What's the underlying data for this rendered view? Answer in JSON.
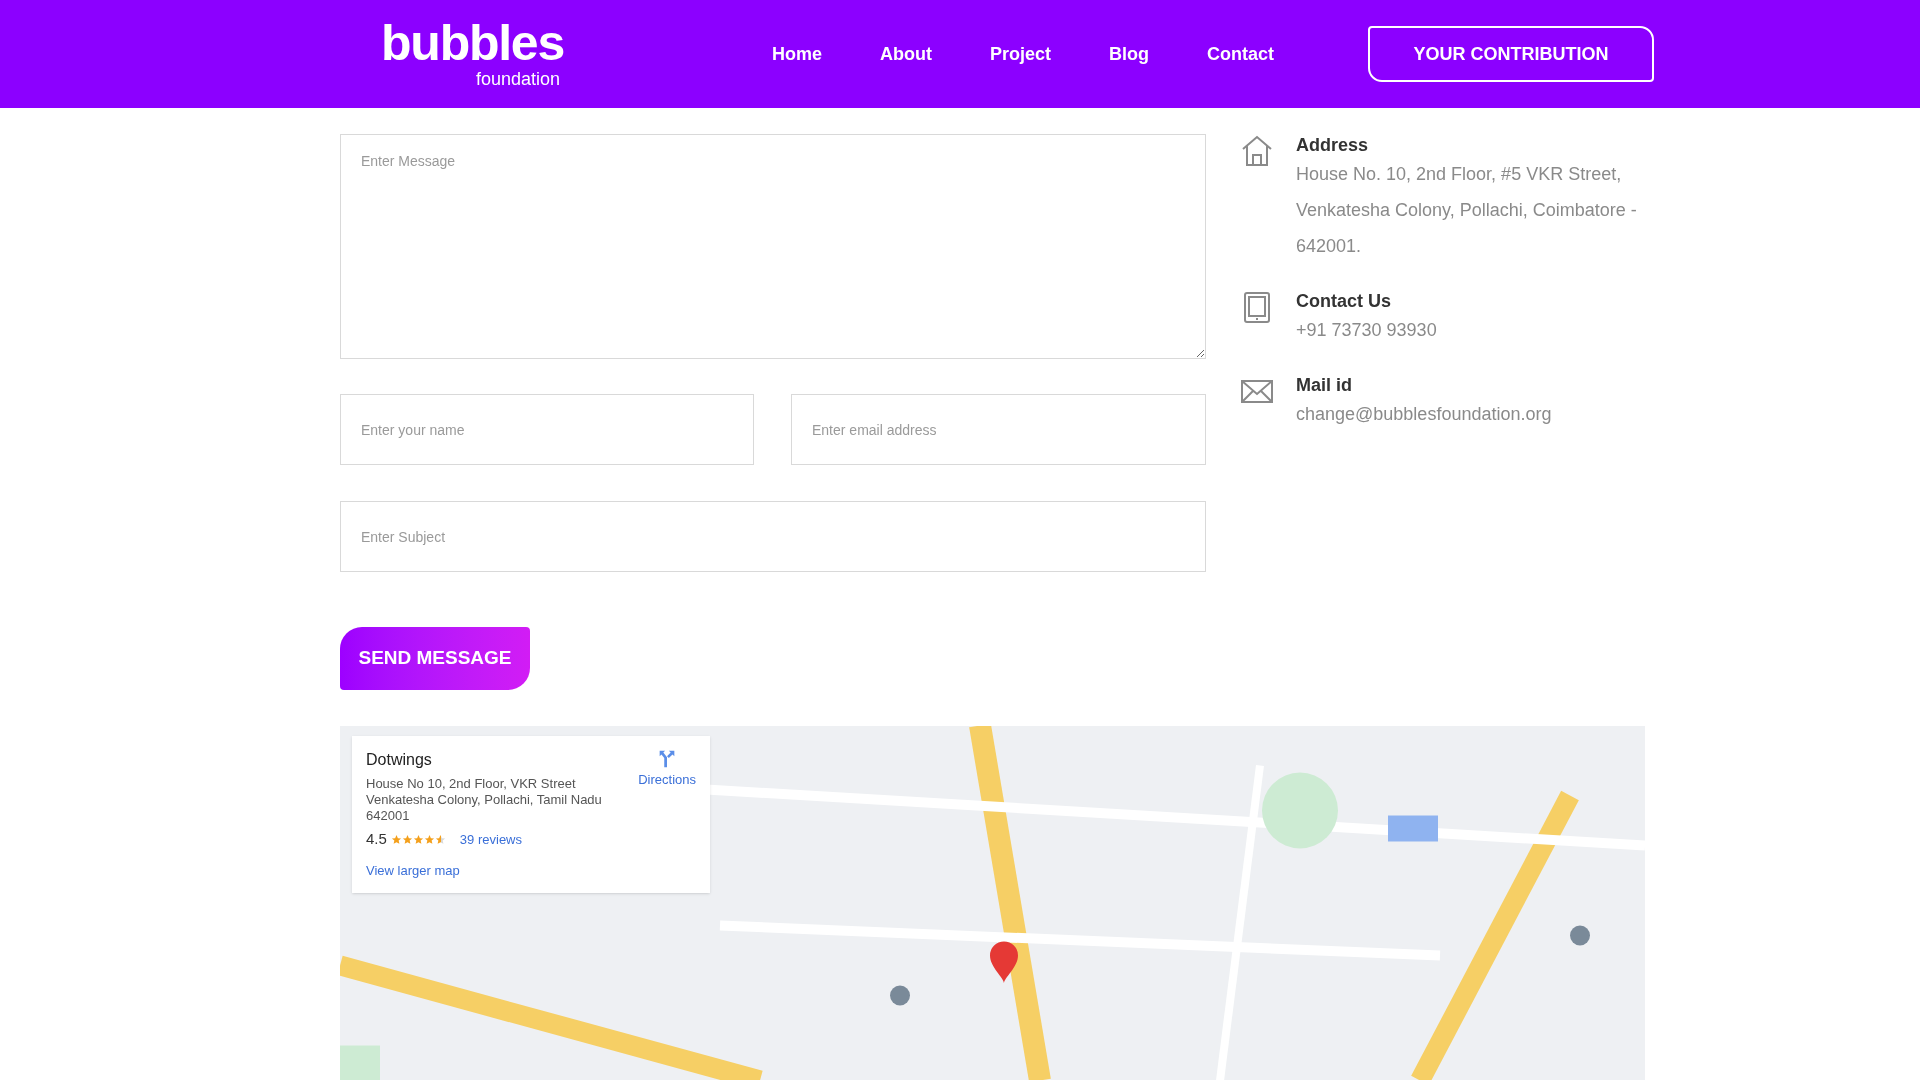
{
  "header": {
    "logo": {
      "word": "bubbles",
      "sub": "foundation"
    },
    "nav": [
      {
        "label": "Home",
        "selected": false
      },
      {
        "label": "About",
        "selected": false
      },
      {
        "label": "Project",
        "selected": false
      },
      {
        "label": "Blog",
        "selected": false
      },
      {
        "label": "Contact",
        "selected": false
      }
    ],
    "cta": "YOUR CONTRIBUTION"
  },
  "form": {
    "message": {
      "placeholder": "Enter Message"
    },
    "name": {
      "placeholder": "Enter your name"
    },
    "email": {
      "placeholder": "Enter email address"
    },
    "subject": {
      "placeholder": "Enter Subject"
    },
    "submit": "SEND MESSAGE"
  },
  "contact": [
    {
      "kind": "address",
      "title": "Address",
      "text": "House No. 10, 2nd Floor, #5 VKR Street, Venkatesha Colony, Pollachi, Coimbatore - 642001."
    },
    {
      "kind": "phone",
      "title": "Contact Us",
      "text": "+91 73730 93930"
    },
    {
      "kind": "mail",
      "title": "Mail id",
      "text": "change@bubblesfoundation.org"
    }
  ],
  "map": {
    "kind": "picture",
    "card": {
      "name": "Dotwings",
      "address": "House No 10, 2nd Floor, VKR Street Venkatesha Colony, Pollachi, Tamil Nadu 642001",
      "rating": "4.5",
      "stars": 4.5,
      "reviews": "39 reviews",
      "directions": "Directions",
      "larger": "View larger map"
    }
  }
}
